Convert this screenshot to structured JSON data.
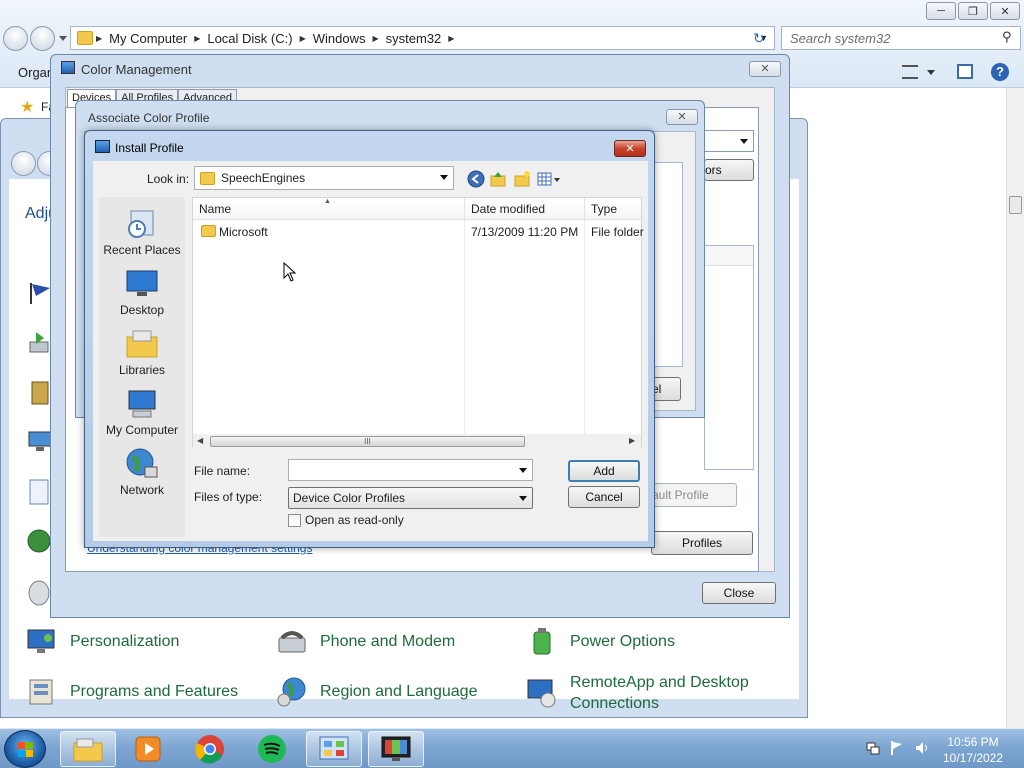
{
  "explorer": {
    "breadcrumbs": [
      "My Computer",
      "Local Disk (C:)",
      "Windows",
      "system32"
    ],
    "search_placeholder": "Search system32",
    "organize_label": "Organ",
    "favorites_label": "Fa"
  },
  "control_panel": {
    "heading": "Adju",
    "items": [
      {
        "label": "Personalization",
        "icon": "personalization-icon"
      },
      {
        "label": "Phone and Modem",
        "icon": "phone-modem-icon"
      },
      {
        "label": "Power Options",
        "icon": "power-options-icon"
      },
      {
        "label": "Programs and Features",
        "icon": "programs-features-icon"
      },
      {
        "label": "Region and Language",
        "icon": "region-language-icon"
      },
      {
        "label_line1": "RemoteApp and Desktop",
        "label_line2": "Connections",
        "icon": "remoteapp-icon"
      }
    ]
  },
  "color_management": {
    "title": "Color Management",
    "tabs": [
      "Devices",
      "All Profiles",
      "Advanced"
    ],
    "behind_button_1": "ors",
    "behind_button_2": "el",
    "default_profile_button": "ault Profile",
    "profiles_button": "Profiles",
    "help_link": "Understanding color management settings",
    "close_button": "Close"
  },
  "associate_profile": {
    "title": "Associate Color Profile"
  },
  "install_profile": {
    "title": "Install Profile",
    "look_in_label": "Look in:",
    "look_in_value": "SpeechEngines",
    "places": [
      "Recent Places",
      "Desktop",
      "Libraries",
      "My Computer",
      "Network"
    ],
    "columns": [
      "Name",
      "Date modified",
      "Type"
    ],
    "rows": [
      {
        "name": "Microsoft",
        "date": "7/13/2009 11:20 PM",
        "type": "File folder"
      }
    ],
    "scroll_grip": "III",
    "file_name_label": "File name:",
    "file_name_value": "",
    "files_of_type_label": "Files of type:",
    "files_of_type_value": "Device Color Profiles",
    "readonly_label": "Open as read-only",
    "readonly_checked": false,
    "add_button": "Add",
    "cancel_button": "Cancel"
  },
  "taskbar": {
    "apps": [
      "start-orb-icon",
      "explorer-icon",
      "media-player-icon",
      "chrome-icon",
      "spotify-icon",
      "control-panel-icon",
      "color-management-icon"
    ],
    "time": "10:56 PM",
    "date": "10/17/2022"
  },
  "colors": {
    "accent_link": "#1e5fb3",
    "cp_green": "#1e6a3a",
    "close_red": "#c7452c"
  }
}
